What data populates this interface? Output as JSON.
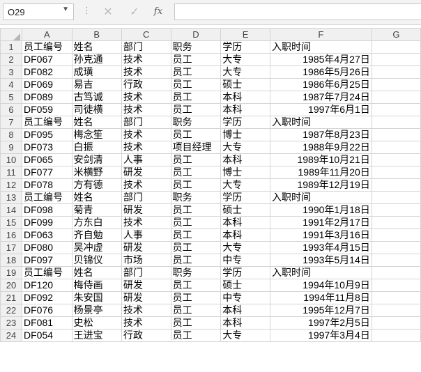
{
  "formula_bar": {
    "cell_ref": "O29",
    "cancel_icon": "✕",
    "enter_icon": "✓",
    "fx_label": "fx",
    "formula": ""
  },
  "columns": [
    "A",
    "B",
    "C",
    "D",
    "E",
    "F",
    "G"
  ],
  "rows": [
    [
      "员工编号",
      "姓名",
      "部门",
      "职务",
      "学历",
      "入职时间"
    ],
    [
      "DF067",
      "孙克通",
      "技术",
      "员工",
      "大专",
      "1985年4月27日"
    ],
    [
      "DF082",
      "成璜",
      "技术",
      "员工",
      "大专",
      "1986年5月26日"
    ],
    [
      "DF069",
      "易吉",
      "行政",
      "员工",
      "硕士",
      "1986年6月25日"
    ],
    [
      "DF089",
      "古笃诚",
      "技术",
      "员工",
      "本科",
      "1987年7月24日"
    ],
    [
      "DF059",
      "司徒横",
      "技术",
      "员工",
      "本科",
      "1997年6月1日"
    ],
    [
      "员工编号",
      "姓名",
      "部门",
      "职务",
      "学历",
      "入职时间"
    ],
    [
      "DF095",
      "梅念笙",
      "技术",
      "员工",
      "博士",
      "1987年8月23日"
    ],
    [
      "DF073",
      "白振",
      "技术",
      "项目经理",
      "大专",
      "1988年9月22日"
    ],
    [
      "DF065",
      "安剑清",
      "人事",
      "员工",
      "本科",
      "1989年10月21日"
    ],
    [
      "DF077",
      "米横野",
      "研发",
      "员工",
      "博士",
      "1989年11月20日"
    ],
    [
      "DF078",
      "方有德",
      "技术",
      "员工",
      "大专",
      "1989年12月19日"
    ],
    [
      "员工编号",
      "姓名",
      "部门",
      "职务",
      "学历",
      "入职时间"
    ],
    [
      "DF098",
      "菊青",
      "研发",
      "员工",
      "硕士",
      "1990年1月18日"
    ],
    [
      "DF099",
      "方东白",
      "技术",
      "员工",
      "本科",
      "1991年2月17日"
    ],
    [
      "DF063",
      "齐自勉",
      "人事",
      "员工",
      "本科",
      "1991年3月16日"
    ],
    [
      "DF080",
      "吴冲虚",
      "研发",
      "员工",
      "大专",
      "1993年4月15日"
    ],
    [
      "DF097",
      "贝锦仪",
      "市场",
      "员工",
      "中专",
      "1993年5月14日"
    ],
    [
      "员工编号",
      "姓名",
      "部门",
      "职务",
      "学历",
      "入职时间"
    ],
    [
      "DF120",
      "梅侍画",
      "研发",
      "员工",
      "硕士",
      "1994年10月9日"
    ],
    [
      "DF092",
      "朱安国",
      "研发",
      "员工",
      "中专",
      "1994年11月8日"
    ],
    [
      "DF076",
      "杨景亭",
      "技术",
      "员工",
      "本科",
      "1995年12月7日"
    ],
    [
      "DF081",
      "史松",
      "技术",
      "员工",
      "本科",
      "1997年2月5日"
    ],
    [
      "DF054",
      "王进宝",
      "行政",
      "员工",
      "大专",
      "1997年3月4日"
    ]
  ]
}
